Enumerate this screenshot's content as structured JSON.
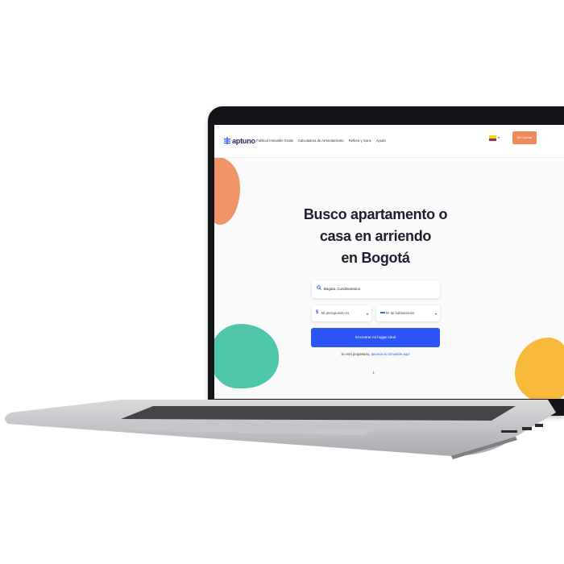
{
  "brand": {
    "name": "aptuno",
    "accent": "#2b56f5",
    "account_color": "#f08a5d"
  },
  "nav": {
    "links": [
      "Publicar Inmueble Gratis",
      "Calculadora de Arrendamiento",
      "Refiera y Gane",
      "Ayuda"
    ],
    "account_label": "Mi Cuenta",
    "country_flag": "colombia-flag-icon"
  },
  "hero": {
    "title_line1": "Busco apartamento o",
    "title_line2": "casa en arriendo",
    "title_line3": "en Bogotá"
  },
  "search": {
    "value": "Bogota, Cundinamarca",
    "icon": "search-icon"
  },
  "filters": {
    "budget_label": "Mi presupuesto es",
    "rooms_label": "Nº de habitaciones"
  },
  "cta_label": "Encontrar mi hogar ideal",
  "owner": {
    "text": "Si eres propietario,",
    "link": "anuncia tu inmueble aquí"
  },
  "colors": {
    "blob_orange": "#f0956a",
    "blob_teal": "#4fc5a9",
    "blob_yellow": "#f6b93b"
  }
}
